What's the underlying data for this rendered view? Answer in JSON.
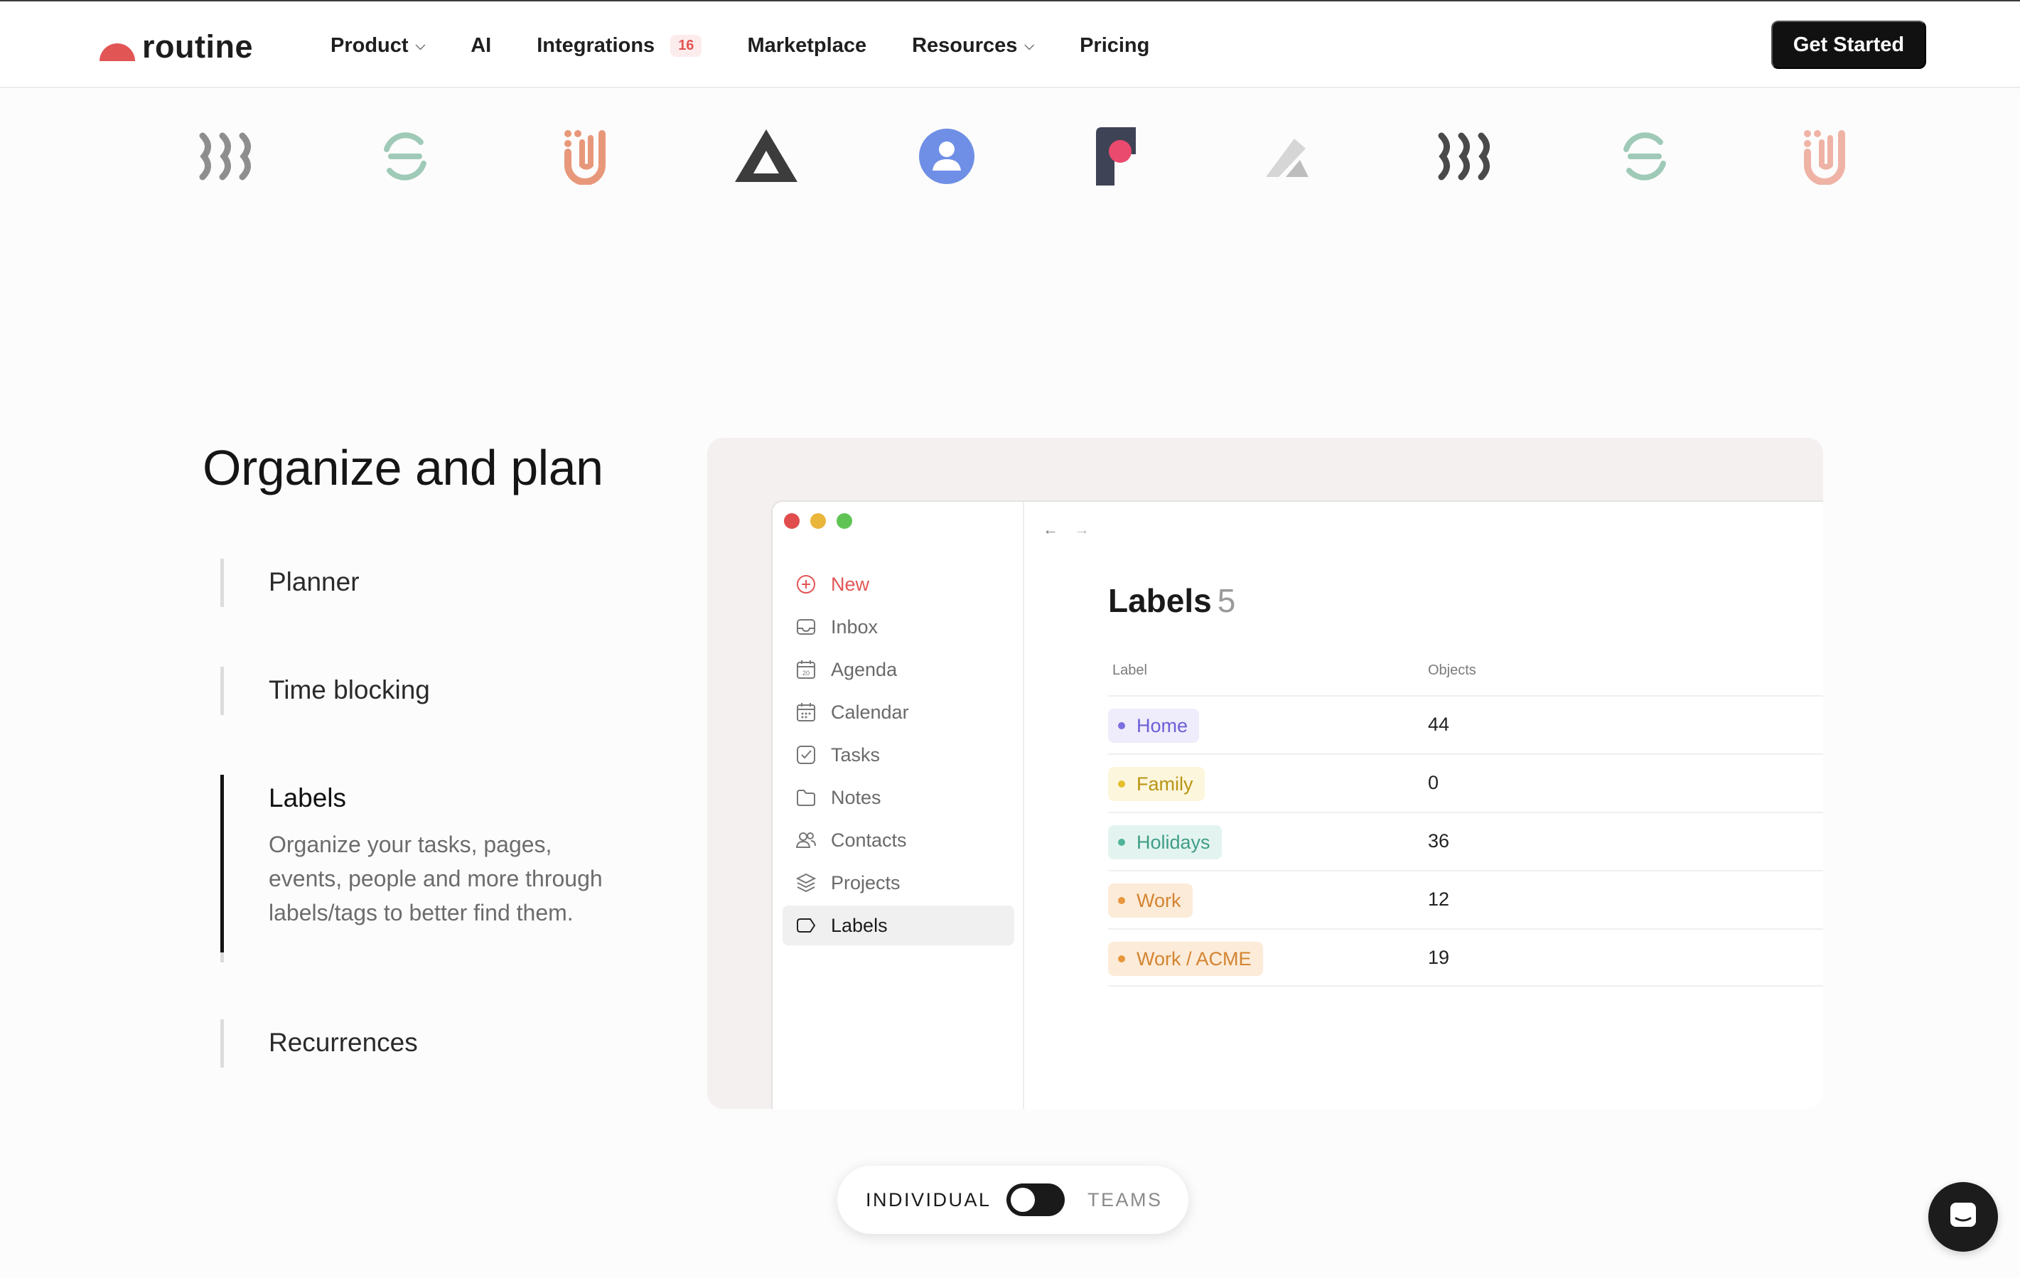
{
  "nav": {
    "logo_text": "routine",
    "links": [
      {
        "label": "Product",
        "has_dropdown": true
      },
      {
        "label": "AI",
        "has_dropdown": false
      },
      {
        "label": "Integrations",
        "badge": "16",
        "has_dropdown": false
      },
      {
        "label": "Marketplace",
        "has_dropdown": false
      },
      {
        "label": "Resources",
        "has_dropdown": true
      },
      {
        "label": "Pricing",
        "has_dropdown": false
      }
    ],
    "cta_label": "Get Started"
  },
  "brand_strip": {
    "icons": [
      "stripes-logo-icon",
      "s-logo-icon",
      "u-logo-icon",
      "triangle-logo-icon",
      "person-circle-logo-icon",
      "f-logo-icon",
      "pen-logo-icon",
      "stripes-logo-icon",
      "s-logo-icon",
      "u-logo-icon"
    ]
  },
  "features": {
    "section_title": "Organize and plan",
    "items": [
      {
        "title": "Planner",
        "active": false
      },
      {
        "title": "Time blocking",
        "active": false
      },
      {
        "title": "Labels",
        "active": true,
        "description": "Organize your tasks, pages, events, people and more through labels/tags to better find them."
      },
      {
        "title": "Recurrences",
        "active": false
      }
    ]
  },
  "mockup": {
    "sidebar": [
      {
        "label": "New",
        "icon": "plus-circle-icon"
      },
      {
        "label": "Inbox",
        "icon": "inbox-icon"
      },
      {
        "label": "Agenda",
        "icon": "agenda-icon"
      },
      {
        "label": "Calendar",
        "icon": "calendar-icon"
      },
      {
        "label": "Tasks",
        "icon": "checkbox-icon"
      },
      {
        "label": "Notes",
        "icon": "folder-icon"
      },
      {
        "label": "Contacts",
        "icon": "contacts-icon"
      },
      {
        "label": "Projects",
        "icon": "layers-icon"
      },
      {
        "label": "Labels",
        "icon": "label-icon",
        "selected": true
      }
    ],
    "agenda_icon_day": "20",
    "title": "Labels",
    "title_count": "5",
    "columns": {
      "label": "Label",
      "objects": "Objects"
    },
    "rows": [
      {
        "label": "Home",
        "objects": "44",
        "bg": "#efecfb",
        "fg": "#6b5fd6",
        "dot": "#7b6fe0"
      },
      {
        "label": "Family",
        "objects": "0",
        "bg": "#fcf6dc",
        "fg": "#b99415",
        "dot": "#e5bf2d"
      },
      {
        "label": "Holidays",
        "objects": "36",
        "bg": "#e3f4f0",
        "fg": "#3f9d87",
        "dot": "#4fb39a"
      },
      {
        "label": "Work",
        "objects": "12",
        "bg": "#fcebd8",
        "fg": "#d38431",
        "dot": "#e8963d"
      },
      {
        "label": "Work / ACME",
        "objects": "19",
        "bg": "#fcebd8",
        "fg": "#d38431",
        "dot": "#e8963d"
      }
    ]
  },
  "plan_toggle": {
    "left_label": "INDIVIDUAL",
    "right_label": "TEAMS",
    "selected": "INDIVIDUAL"
  },
  "colors": {
    "accent": "#e25555",
    "dark": "#111111"
  }
}
